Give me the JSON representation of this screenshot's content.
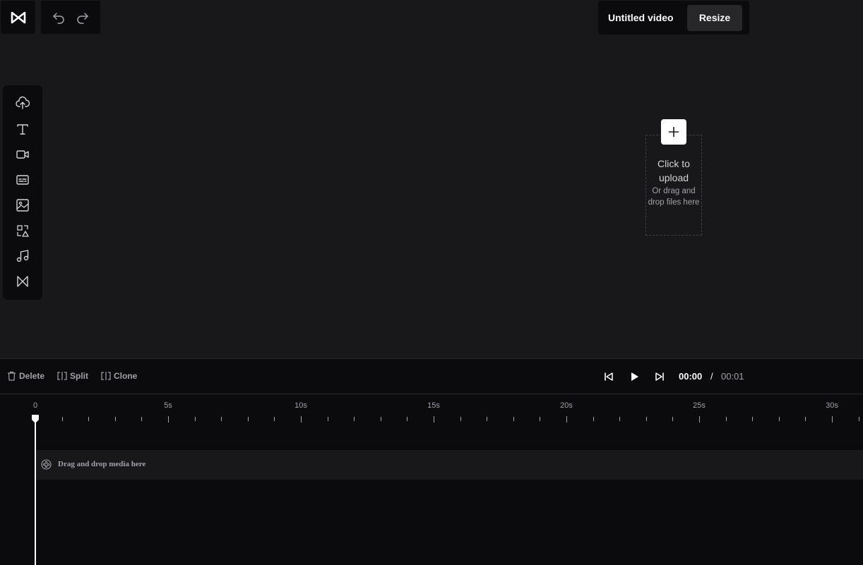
{
  "app": {
    "logo_icon": "capcut-logo-icon"
  },
  "header": {
    "undo_icon": "undo-icon",
    "redo_icon": "redo-icon",
    "project_title": "Untitled video",
    "resize_label": "Resize"
  },
  "sidebar": {
    "tools": [
      {
        "name": "upload",
        "icon": "cloud-upload-icon"
      },
      {
        "name": "text",
        "icon": "text-icon"
      },
      {
        "name": "video",
        "icon": "video-camera-icon"
      },
      {
        "name": "captions",
        "icon": "captions-icon"
      },
      {
        "name": "image",
        "icon": "image-icon"
      },
      {
        "name": "elements",
        "icon": "shapes-icon"
      },
      {
        "name": "audio",
        "icon": "music-note-icon"
      },
      {
        "name": "transitions",
        "icon": "transition-icon"
      }
    ]
  },
  "upload": {
    "title": "Click to upload",
    "subtitle": "Or drag and drop files here"
  },
  "controls": {
    "delete_label": "Delete",
    "split_label": "Split",
    "clone_label": "Clone",
    "current_time": "00:00",
    "separator": "/",
    "total_time": "00:01"
  },
  "timeline": {
    "ruler_labels": [
      "0",
      "5s",
      "10s",
      "15s",
      "20s",
      "25s",
      "30s"
    ],
    "track_placeholder": "Drag and drop media here",
    "playhead_seconds": 0
  },
  "colors": {
    "background": "#18181b",
    "panel": "#0b0b0d",
    "accent": "#ffffff",
    "muted_text": "#a1a1aa"
  }
}
